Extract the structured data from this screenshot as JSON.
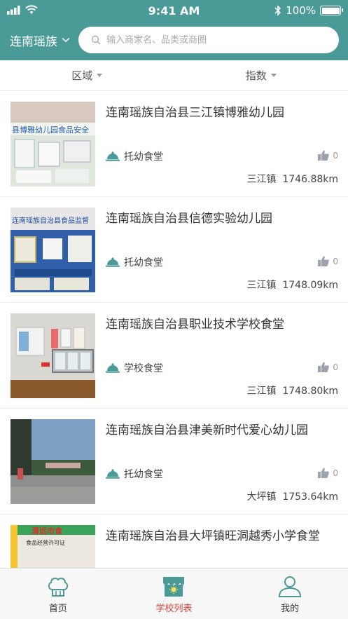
{
  "status_bar": {
    "time": "9:41 AM",
    "battery": "100%"
  },
  "header": {
    "region": "连南瑶族",
    "search_placeholder": "输入商家名、品类或商圈"
  },
  "filters": [
    {
      "label": "区域"
    },
    {
      "label": "指数"
    }
  ],
  "list": [
    {
      "name": "连南瑶族自治县三江镇博雅幼儿园",
      "category": "托幼食堂",
      "likes": "0",
      "town": "三江镇",
      "distance": "1746.88km",
      "thumb_text": "县博雅幼儿园食品安全"
    },
    {
      "name": "连南瑶族自治县信德实验幼儿园",
      "category": "托幼食堂",
      "likes": "0",
      "town": "三江镇",
      "distance": "1748.09km",
      "thumb_text": "连南瑶族自治县食品监督"
    },
    {
      "name": "连南瑶族自治县职业技术学校食堂",
      "category": "学校食堂",
      "likes": "0",
      "town": "三江镇",
      "distance": "1748.80km"
    },
    {
      "name": "连南瑶族自治县津美新时代爱心幼儿园",
      "category": "托幼食堂",
      "likes": "0",
      "town": "大坪镇",
      "distance": "1753.64km"
    },
    {
      "name": "连南瑶族自治县大坪镇旺洞越秀小学食堂",
      "category": "",
      "likes": "",
      "town": "",
      "distance": "",
      "thumb_text": "清远市食",
      "thumb_text2": "食品经营许可证"
    }
  ],
  "tabbar": [
    {
      "label": "首页"
    },
    {
      "label": "学校列表"
    },
    {
      "label": "我的"
    }
  ],
  "colors": {
    "header": "#4a9a98",
    "active_tab": "#e0433b",
    "icon_teal": "#4a9a98"
  }
}
